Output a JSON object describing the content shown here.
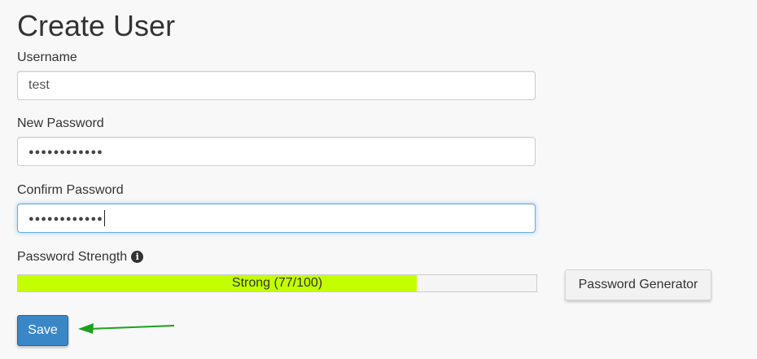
{
  "page": {
    "title": "Create User"
  },
  "form": {
    "username": {
      "label": "Username",
      "value": "test"
    },
    "new_password": {
      "label": "New Password",
      "value": "●●●●●●●●●●●●"
    },
    "confirm_password": {
      "label": "Confirm Password",
      "value": "●●●●●●●●●●●●",
      "focused": true
    },
    "strength": {
      "label": "Password Strength",
      "info_icon": "info-icon",
      "text": "Strong (77/100)",
      "score": 77,
      "max": 100,
      "fill_color": "#c4ff00"
    },
    "generator_label": "Password Generator",
    "save_label": "Save"
  },
  "colors": {
    "primary_button": "#3a87c8",
    "annotation_arrow": "#1aa31a"
  }
}
